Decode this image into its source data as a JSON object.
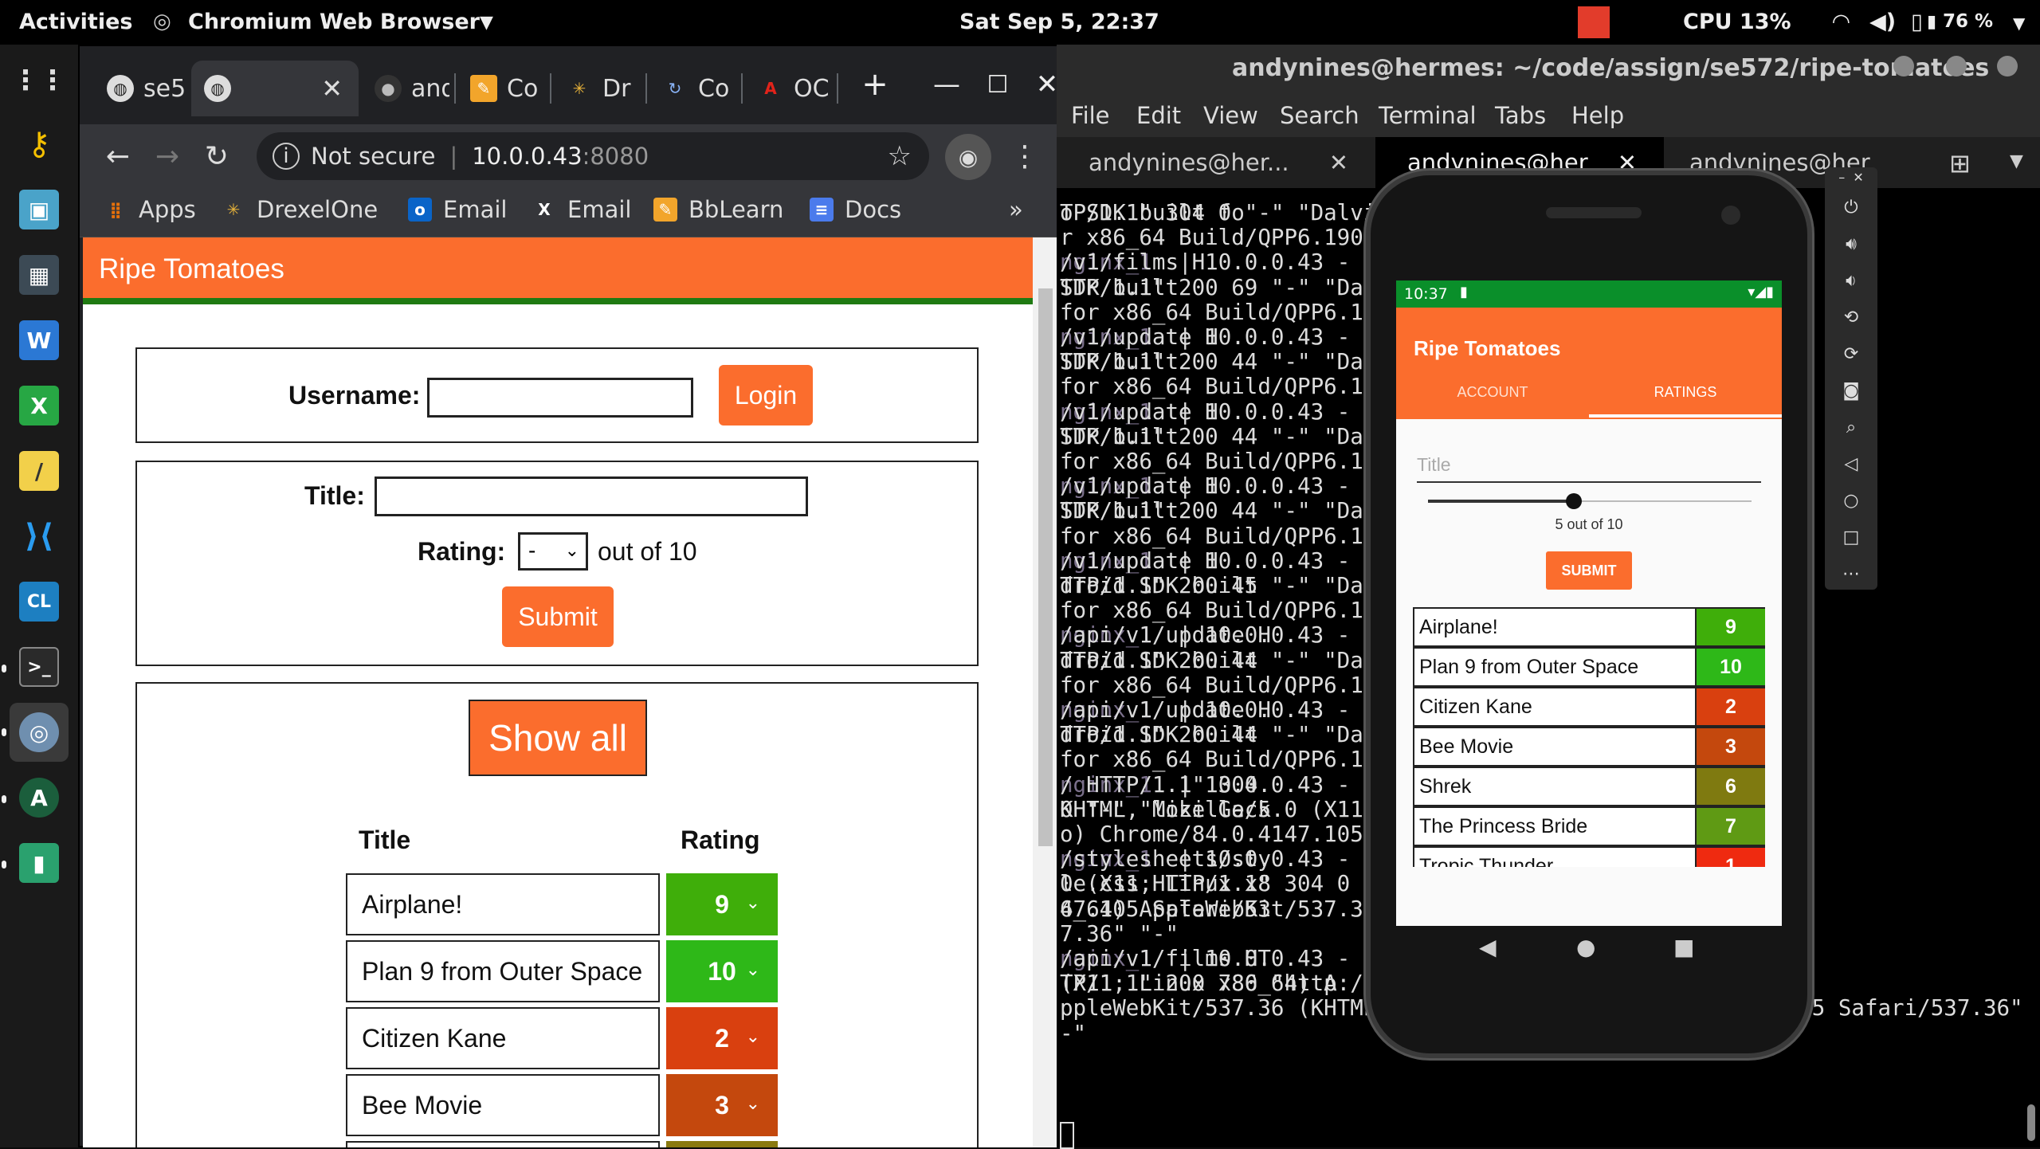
{
  "topbar": {
    "activities": "Activities",
    "app_name": "Chromium Web Browser",
    "clock": "Sat Sep  5, 22:37",
    "cpu": "CPU 13%",
    "battery": "76 %"
  },
  "browser": {
    "tabs": [
      {
        "label": "se5",
        "icon": "globe-icon"
      },
      {
        "label": "",
        "icon": "globe-icon"
      },
      {
        "label": "and",
        "icon": "github-icon"
      },
      {
        "label": "Co",
        "icon": "edit-icon"
      },
      {
        "label": "Dr",
        "icon": "drexel-icon"
      },
      {
        "label": "Co",
        "icon": "refresh-icon"
      },
      {
        "label": "OC",
        "icon": "pdf-icon"
      }
    ],
    "omnibox": {
      "security": "Not secure",
      "host": "10.0.0.43",
      "port": ":8080"
    },
    "bookmarks": [
      {
        "label": "Apps",
        "icon": "apps-grid-icon"
      },
      {
        "label": "DrexelOne",
        "icon": "drexel-icon"
      },
      {
        "label": "Email",
        "icon": "outlook-icon"
      },
      {
        "label": "Email",
        "icon": "x-icon"
      },
      {
        "label": "BbLearn",
        "icon": "edit-icon"
      },
      {
        "label": "Docs",
        "icon": "docs-icon"
      }
    ],
    "bookmarks_more": "»"
  },
  "webapp": {
    "title": "Ripe Tomatoes",
    "login": {
      "username_label": "Username:",
      "username_value": "",
      "login_button": "Login"
    },
    "rate": {
      "title_label": "Title:",
      "title_value": "",
      "rating_label": "Rating:",
      "rating_selected": "-",
      "out_of": "out of 10",
      "submit_button": "Submit"
    },
    "list": {
      "show_all_button": "Show all",
      "col_title": "Title",
      "col_rating": "Rating",
      "rows": [
        {
          "title": "Airplane!",
          "rating": "9",
          "color": "#3fae0a"
        },
        {
          "title": "Plan 9 from Outer Space",
          "rating": "10",
          "color": "#2eb818"
        },
        {
          "title": "Citizen Kane",
          "rating": "2",
          "color": "#d9400f"
        },
        {
          "title": "Bee Movie",
          "rating": "3",
          "color": "#c4480d"
        }
      ]
    }
  },
  "terminal": {
    "window_title": "andynines@hermes: ~/code/assign/se572/ripe-tomatoes",
    "menu": [
      "File",
      "Edit",
      "View",
      "Search",
      "Terminal",
      "Tabs",
      "Help"
    ],
    "tabs": [
      "andynines@her...",
      "andynines@her",
      "andynines@her"
    ],
    "lines": [
      {
        "pre": "",
        "text": "TP/1.1\" 304 0 \"-\" \"Dalvik",
        "right": "o SDK built fo"
      },
      {
        "pre": "",
        "text": "r x86_64 Build/QPP6.1907",
        "right": ""
      },
      {
        "pre": "nginx_1",
        "text": "  | 10.0.0.43 - -",
        "right": "/v1/films H"
      },
      {
        "pre": "",
        "text": "TTP/1.1\" 200 69 \"-\" \"Dal",
        "right": "SDK built"
      },
      {
        "pre": "",
        "text": "for x86_64 Build/QPP6.19",
        "right": ""
      },
      {
        "pre": "nginx_1",
        "text": "  | 10.0.0.43 - -",
        "right": "/v1/update H"
      },
      {
        "pre": "",
        "text": "TTP/1.1\" 200 44 \"-\" \"Dal",
        "right": "SDK built"
      },
      {
        "pre": "",
        "text": "for x86_64 Build/QPP6.19",
        "right": ""
      },
      {
        "pre": "nginx_1",
        "text": "  | 10.0.0.43 - -",
        "right": "/v1/update H"
      },
      {
        "pre": "",
        "text": "TTP/1.1\" 200 44 \"-\" \"Dal",
        "right": "SDK built"
      },
      {
        "pre": "",
        "text": "for x86_64 Build/QPP6.19",
        "right": ""
      },
      {
        "pre": "nginx_1",
        "text": "  | 10.0.0.43 - -",
        "right": "/v1/update H"
      },
      {
        "pre": "",
        "text": "TTP/1.1\" 200 44 \"-\" \"Dal",
        "right": "SDK built"
      },
      {
        "pre": "",
        "text": "for x86_64 Build/QPP6.19",
        "right": ""
      },
      {
        "pre": "nginx_1",
        "text": "  | 10.0.0.43 - -",
        "right": "/v1/update H"
      },
      {
        "pre": "",
        "text": "TTP/1.1\" 200 45 \"-\" \"Dal",
        "right": "droid SDK built"
      },
      {
        "pre": "",
        "text": "for x86_64 Build/QPP6.19",
        "right": ""
      },
      {
        "pre": "nginx_1",
        "text": "  | 10.0.0.43 - -",
        "right": "/api/v1/update H"
      },
      {
        "pre": "",
        "text": "TTP/1.1\" 200 44 \"-\" \"Dal",
        "right": "droid SDK built"
      },
      {
        "pre": "",
        "text": "for x86_64 Build/QPP6.19",
        "right": ""
      },
      {
        "pre": "nginx_1",
        "text": "  | 10.0.0.43 - -",
        "right": "/api/v1/update H"
      },
      {
        "pre": "",
        "text": "TTP/1.1\" 200 44 \"-\" \"Dal",
        "right": "droid SDK built"
      },
      {
        "pre": "",
        "text": "for x86_64 Build/QPP6.19",
        "right": ""
      },
      {
        "pre": "nginx_1",
        "text": "  | 10.0.0.43 - -",
        "right": "/ HTTP/1.1\" 304"
      },
      {
        "pre": "",
        "text": "0 \"-\" \"Mozilla/5.0 (X11;",
        "right": "KHTML, like Geck"
      },
      {
        "pre": "",
        "text": "o) Chrome/84.0.4147.105",
        "right": ""
      },
      {
        "pre": "nginx_1",
        "text": "  | 10.0.0.43 - -",
        "right": "/stylesheets/sty"
      },
      {
        "pre": "",
        "text": "le.css HTTP/1.1\" 304 0 \"",
        "right": "0 (X11; Linux x8"
      },
      {
        "pre": "",
        "text": "6_64) AppleWebKit/537.36",
        "right": "47.105 Safari/53"
      },
      {
        "pre": "",
        "text": "7.36\" \"-\"",
        "right": ""
      },
      {
        "pre": "nginx_1",
        "text": "  | 10.0.0.43 - -",
        "right": "/api/v1/films HT"
      },
      {
        "pre": "",
        "text": "TP/1.1\" 200 780 \"http://10.0.0.4",
        "right": "(X11; Linux x86_64) A"
      },
      {
        "pre": "",
        "text": "ppleWebKit/537.36 (KHTML, like Gecko) Chrome/84.0.4147.105 Safari/537.36\" \"",
        "right": ""
      },
      {
        "pre": "",
        "text": "-\"",
        "right": ""
      }
    ]
  },
  "phone": {
    "time": "10:37",
    "app_title": "Ripe Tomatoes",
    "tabs": [
      "ACCOUNT",
      "RATINGS"
    ],
    "title_placeholder": "Title",
    "slider_value": 5,
    "slider_max": 10,
    "slider_label": "5 out of 10",
    "submit": "SUBMIT",
    "rows": [
      {
        "title": "Airplane!",
        "rating": "9",
        "color": "#3fae0a"
      },
      {
        "title": "Plan 9 from Outer Space",
        "rating": "10",
        "color": "#2eb818"
      },
      {
        "title": "Citizen Kane",
        "rating": "2",
        "color": "#d9400f"
      },
      {
        "title": "Bee Movie",
        "rating": "3",
        "color": "#c4480d"
      },
      {
        "title": "Shrek",
        "rating": "6",
        "color": "#7f7a10"
      },
      {
        "title": "The Princess Bride",
        "rating": "7",
        "color": "#5f9a14"
      },
      {
        "title": "Tropic Thunder",
        "rating": "1",
        "color": "#ef2a10"
      }
    ]
  }
}
